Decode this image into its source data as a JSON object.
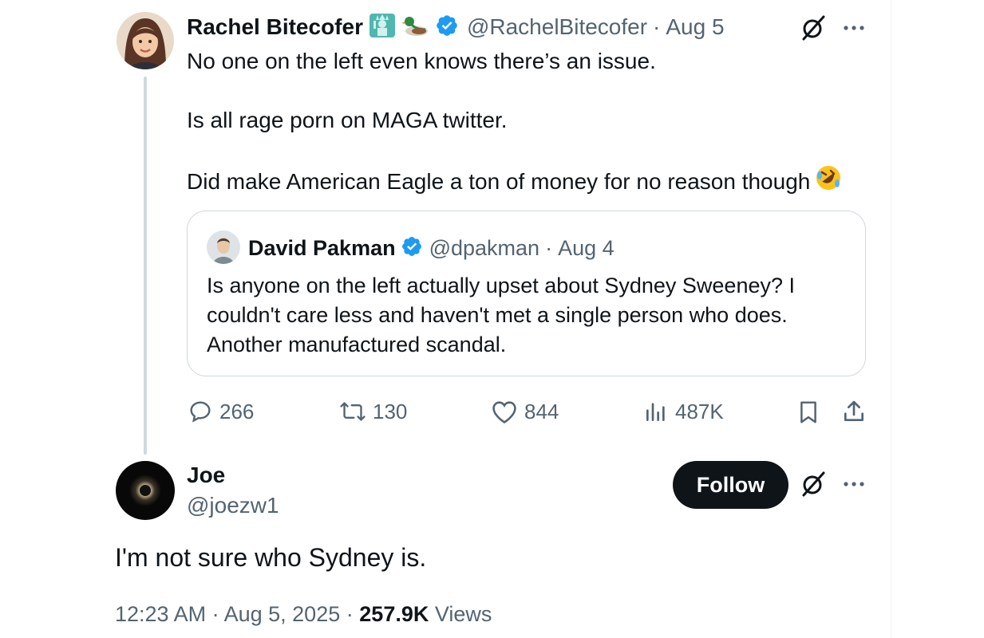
{
  "main_tweet": {
    "author_name": "Rachel Bitecofer",
    "handle": "@RachelBitecofer",
    "sep": "·",
    "date": "Aug 5",
    "name_emojis": [
      "statue-of-liberty-icon",
      "duck-icon"
    ],
    "lines": [
      "No one on the left even knows there’s an issue.",
      "Is all rage porn on MAGA twitter.",
      "Did make American Eagle a ton of money for no reason though"
    ],
    "end_emoji": "rolling-on-floor-laughing-icon",
    "stats": {
      "replies": "266",
      "reposts": "130",
      "likes": "844",
      "views": "487K"
    }
  },
  "quoted_tweet": {
    "author_name": "David Pakman",
    "handle": "@dpakman",
    "sep": "·",
    "date": "Aug 4",
    "lines": [
      "Is anyone on the left actually upset about Sydney Sweeney? I",
      "couldn't care less and haven't met a single person who does.",
      "Another manufactured scandal."
    ]
  },
  "reply_tweet": {
    "author_name": "Joe",
    "handle": "@joezw1",
    "follow_label": "Follow",
    "text": "I'm not sure who Sydney is.",
    "time": "12:23 AM",
    "sep1": "·",
    "date": "Aug 5, 2025",
    "sep2": "·",
    "views_count": "257.9K",
    "views_label": "Views"
  },
  "colors": {
    "verified": "#1d9bf0",
    "secondary_text": "#536471",
    "border": "#cfd9de",
    "primary_text": "#0f1419"
  }
}
